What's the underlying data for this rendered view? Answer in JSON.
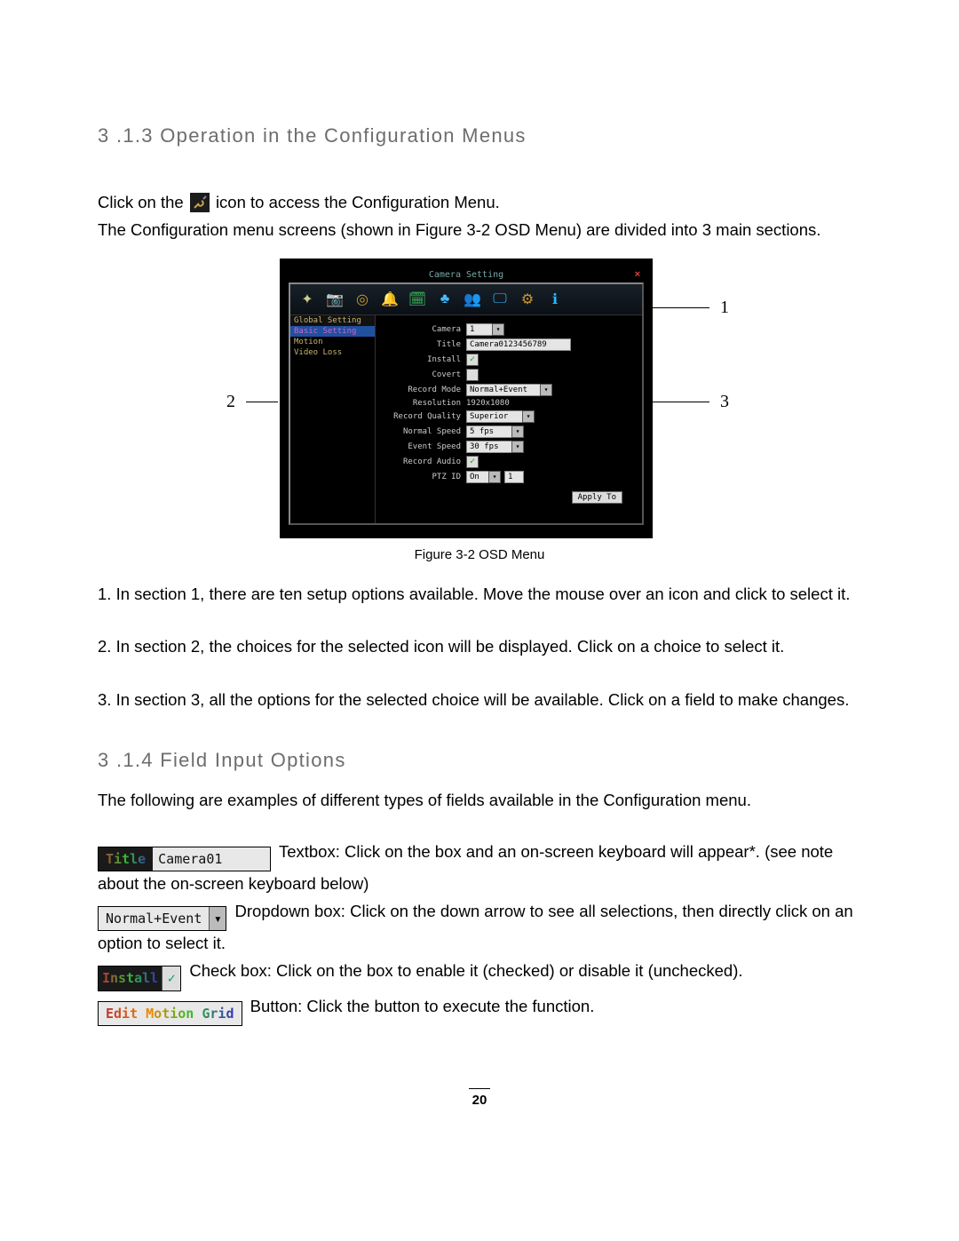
{
  "headings": {
    "s313": "3 .1.3   Operation in the Configuration Menus",
    "s314": "3 .1.4   Field Input Options"
  },
  "paragraphs": {
    "p1a": "Click on the ",
    "p1b": " icon to access the Configuration Menu.",
    "p2": "The Configuration menu screens (shown in Figure 3-2 OSD Menu) are divided into 3 main sections.",
    "list1": "1. In section 1, there are ten setup options available. Move the mouse over an icon and click to select it.",
    "list2": "2. In section 2, the choices for the selected icon will be displayed. Click on a choice to select it.",
    "list3": "3. In section 3, all the options for the selected choice will be available. Click on a field to make changes.",
    "p314": "The following are examples of different types of fields available in the Configuration menu.",
    "ex_tb_a": "Textbox: ",
    "ex_tb_b": "Click on the box and an on-screen keyboard will appear*. (see note about the on-screen keyboard below)",
    "ex_dd_a": "Dropdown box: ",
    "ex_dd_b": "Click on the down arrow to see all selections, then directly click on an option to select it.",
    "ex_cb_a": "Check box: ",
    "ex_cb_b": "Click on the box to enable it (checked) or disable it (unchecked).",
    "ex_bt_a": "Button: ",
    "ex_bt_b": "Click the button to execute the function."
  },
  "figure_caption": "Figure 3-2 OSD Menu",
  "callouts": {
    "c1": "1",
    "c2": "2",
    "c3": "3"
  },
  "page_number": "20",
  "osd": {
    "title": "Camera Setting",
    "sidebar": {
      "header": "Global Setting",
      "items": [
        "Basic Setting",
        "Motion",
        "Video Loss"
      ],
      "selected_index": 0
    },
    "form": {
      "camera": {
        "label": "Camera",
        "value": "1"
      },
      "title": {
        "label": "Title",
        "value": "Camera0123456789"
      },
      "install": {
        "label": "Install",
        "checked": true
      },
      "covert": {
        "label": "Covert",
        "checked": false
      },
      "record_mode": {
        "label": "Record Mode",
        "value": "Normal+Event"
      },
      "resolution": {
        "label": "Resolution",
        "value": "1920x1080"
      },
      "record_quality": {
        "label": "Record Quality",
        "value": "Superior"
      },
      "normal_speed": {
        "label": "Normal Speed",
        "value": "5 fps"
      },
      "event_speed": {
        "label": "Event Speed",
        "value": "30 fps"
      },
      "record_audio": {
        "label": "Record Audio",
        "checked": true
      },
      "ptz_id": {
        "label": "PTZ ID",
        "value": "On",
        "num": "1"
      },
      "apply": "Apply To"
    },
    "toolbar_icons": [
      {
        "name": "express-icon",
        "glyph": "✦",
        "color": "#cc8"
      },
      {
        "name": "camera-icon",
        "glyph": "📷",
        "color": "#8cf"
      },
      {
        "name": "record-icon",
        "glyph": "◎",
        "color": "#c93"
      },
      {
        "name": "alarm-icon",
        "glyph": "🔔",
        "color": "#fc4"
      },
      {
        "name": "schedule-icon",
        "glyph": "🗓",
        "color": "#4c6"
      },
      {
        "name": "network-icon",
        "glyph": "♣",
        "color": "#4bf"
      },
      {
        "name": "users-icon",
        "glyph": "👥",
        "color": "#ec2"
      },
      {
        "name": "display-icon",
        "glyph": "🖵",
        "color": "#3bf"
      },
      {
        "name": "system-icon",
        "glyph": "⚙",
        "color": "#c93"
      },
      {
        "name": "info-icon",
        "glyph": "ℹ",
        "color": "#2bf"
      }
    ]
  },
  "examples": {
    "title_label": "Title",
    "title_value": "Camera01",
    "dropdown_value": "Normal+Event",
    "check_label": "Install",
    "button_label": "Edit Motion Grid"
  }
}
